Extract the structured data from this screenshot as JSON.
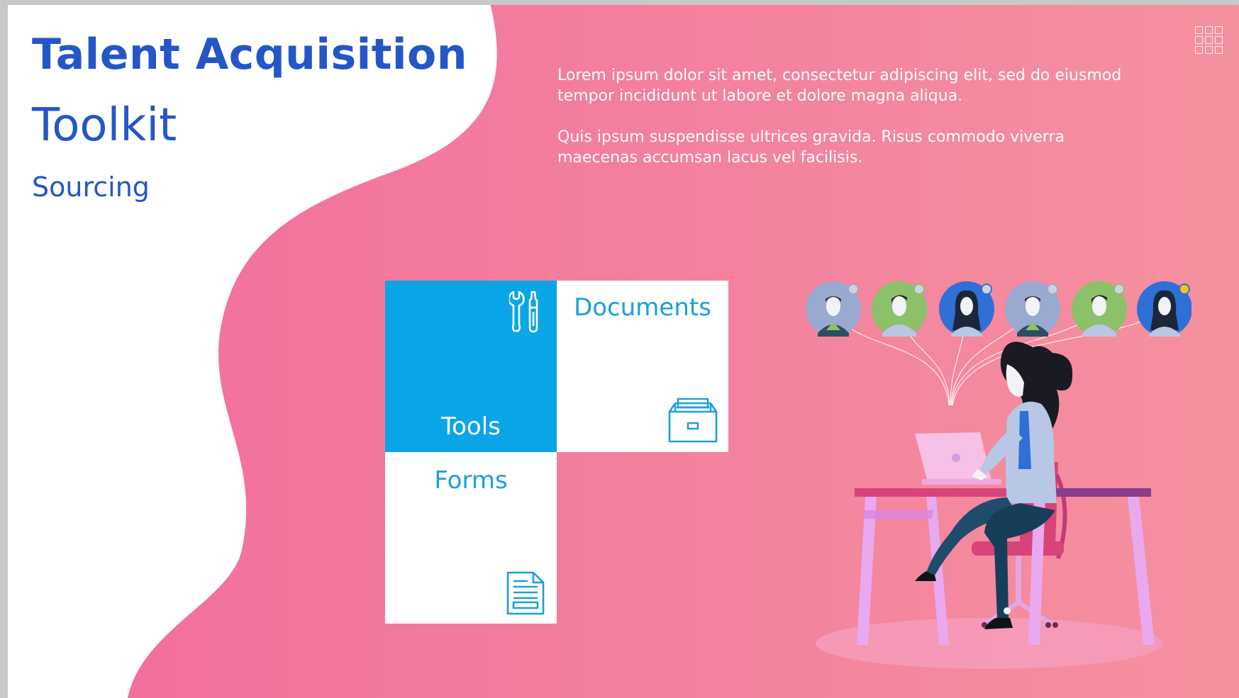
{
  "header": {
    "title": "Talent Acquisition",
    "subtitle": "Toolkit",
    "section": "Sourcing"
  },
  "menu": {
    "icon": "grid-menu-icon"
  },
  "intro": {
    "paragraph_1": "Lorem ipsum dolor sit amet, consectetur adipiscing elit, sed do eiusmod tempor incididunt ut labore et dolore magna aliqua.",
    "paragraph_2": "Quis ipsum suspendisse ultrices gravida. Risus commodo viverra maecenas accumsan lacus vel facilisis."
  },
  "tiles": [
    {
      "label": "Tools",
      "icon": "wrench-screwdriver-icon"
    },
    {
      "label": "Documents",
      "icon": "filing-cabinet-icon"
    },
    {
      "label": "Forms",
      "icon": "document-icon"
    }
  ],
  "colors": {
    "brand_blue": "#2456c6",
    "tile_blue": "#0aa5e6",
    "pink_start": "#f3749e",
    "pink_end": "#f58ea0"
  }
}
